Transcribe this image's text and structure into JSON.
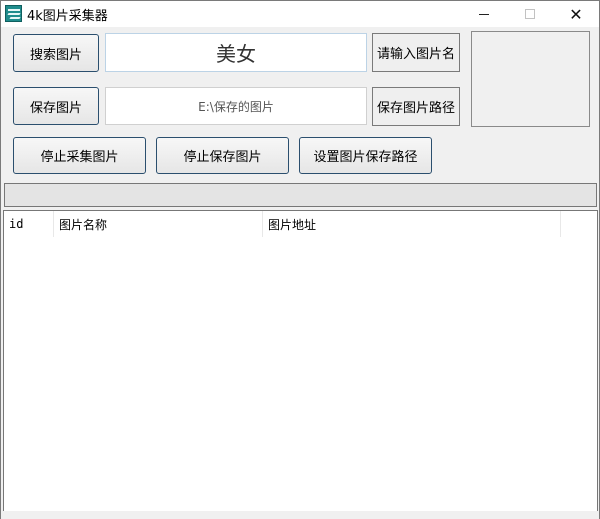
{
  "window": {
    "title": "4k图片采集器",
    "minimize_label": "minimize",
    "maximize_label": "maximize",
    "close_label": "✕"
  },
  "search": {
    "button_label": "搜索图片",
    "keyword_value": "美女",
    "hint_button_label": "请输入图片名"
  },
  "save": {
    "button_label": "保存图片",
    "path_value": "E:\\保存的图片",
    "path_button_label": "保存图片路径"
  },
  "actions": {
    "stop_collect_label": "停止采集图片",
    "stop_save_label": "停止保存图片",
    "set_path_label": "设置图片保存路径"
  },
  "list": {
    "columns": [
      "id",
      "图片名称",
      "图片地址"
    ],
    "rows": []
  }
}
